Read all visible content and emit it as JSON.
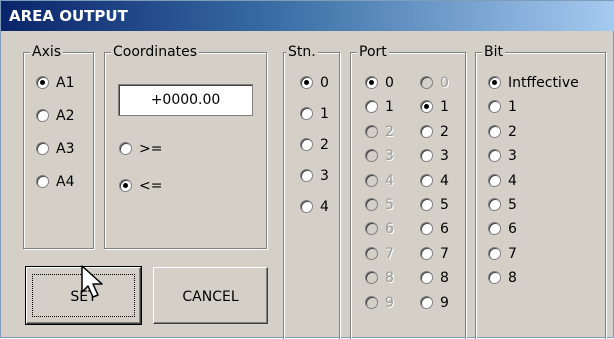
{
  "window": {
    "title": "AREA OUTPUT"
  },
  "axis": {
    "label": "Axis",
    "options": [
      {
        "label": "A1",
        "checked": true
      },
      {
        "label": "A2",
        "checked": false
      },
      {
        "label": "A3",
        "checked": false
      },
      {
        "label": "A4",
        "checked": false
      }
    ]
  },
  "coordinates": {
    "label": "Coordinates",
    "value": "+0000.00",
    "options": [
      {
        "label": ">=",
        "checked": false
      },
      {
        "label": "<=",
        "checked": true
      }
    ]
  },
  "station": {
    "label": "Stn.",
    "options": [
      {
        "label": "0",
        "checked": true
      },
      {
        "label": "1",
        "checked": false
      },
      {
        "label": "2",
        "checked": false
      },
      {
        "label": "3",
        "checked": false
      },
      {
        "label": "4",
        "checked": false
      }
    ]
  },
  "port": {
    "label": "Port",
    "left": [
      {
        "label": "0",
        "checked": true,
        "disabled": false
      },
      {
        "label": "1",
        "checked": false,
        "disabled": false
      },
      {
        "label": "2",
        "checked": false,
        "disabled": true
      },
      {
        "label": "3",
        "checked": false,
        "disabled": true
      },
      {
        "label": "4",
        "checked": false,
        "disabled": true
      },
      {
        "label": "5",
        "checked": false,
        "disabled": true
      },
      {
        "label": "6",
        "checked": false,
        "disabled": true
      },
      {
        "label": "7",
        "checked": false,
        "disabled": true
      },
      {
        "label": "8",
        "checked": false,
        "disabled": true
      },
      {
        "label": "9",
        "checked": false,
        "disabled": true
      }
    ],
    "right": [
      {
        "label": "0",
        "checked": false,
        "disabled": true
      },
      {
        "label": "1",
        "checked": true,
        "disabled": false
      },
      {
        "label": "2",
        "checked": false,
        "disabled": false
      },
      {
        "label": "3",
        "checked": false,
        "disabled": false
      },
      {
        "label": "4",
        "checked": false,
        "disabled": false
      },
      {
        "label": "5",
        "checked": false,
        "disabled": false
      },
      {
        "label": "6",
        "checked": false,
        "disabled": false
      },
      {
        "label": "7",
        "checked": false,
        "disabled": false
      },
      {
        "label": "8",
        "checked": false,
        "disabled": false
      },
      {
        "label": "9",
        "checked": false,
        "disabled": false
      }
    ]
  },
  "bit": {
    "label": "Bit",
    "options": [
      {
        "label": "Intffective",
        "checked": true
      },
      {
        "label": "1",
        "checked": false
      },
      {
        "label": "2",
        "checked": false
      },
      {
        "label": "3",
        "checked": false
      },
      {
        "label": "4",
        "checked": false
      },
      {
        "label": "5",
        "checked": false
      },
      {
        "label": "6",
        "checked": false
      },
      {
        "label": "7",
        "checked": false
      },
      {
        "label": "8",
        "checked": false
      }
    ]
  },
  "buttons": {
    "set": "SET",
    "cancel": "CANCEL"
  },
  "icons": {
    "cursor": "mouse-pointer-icon"
  },
  "colors": {
    "titlebar_start": "#0a246a",
    "titlebar_end": "#a6caf0",
    "face": "#d4d0c8"
  }
}
